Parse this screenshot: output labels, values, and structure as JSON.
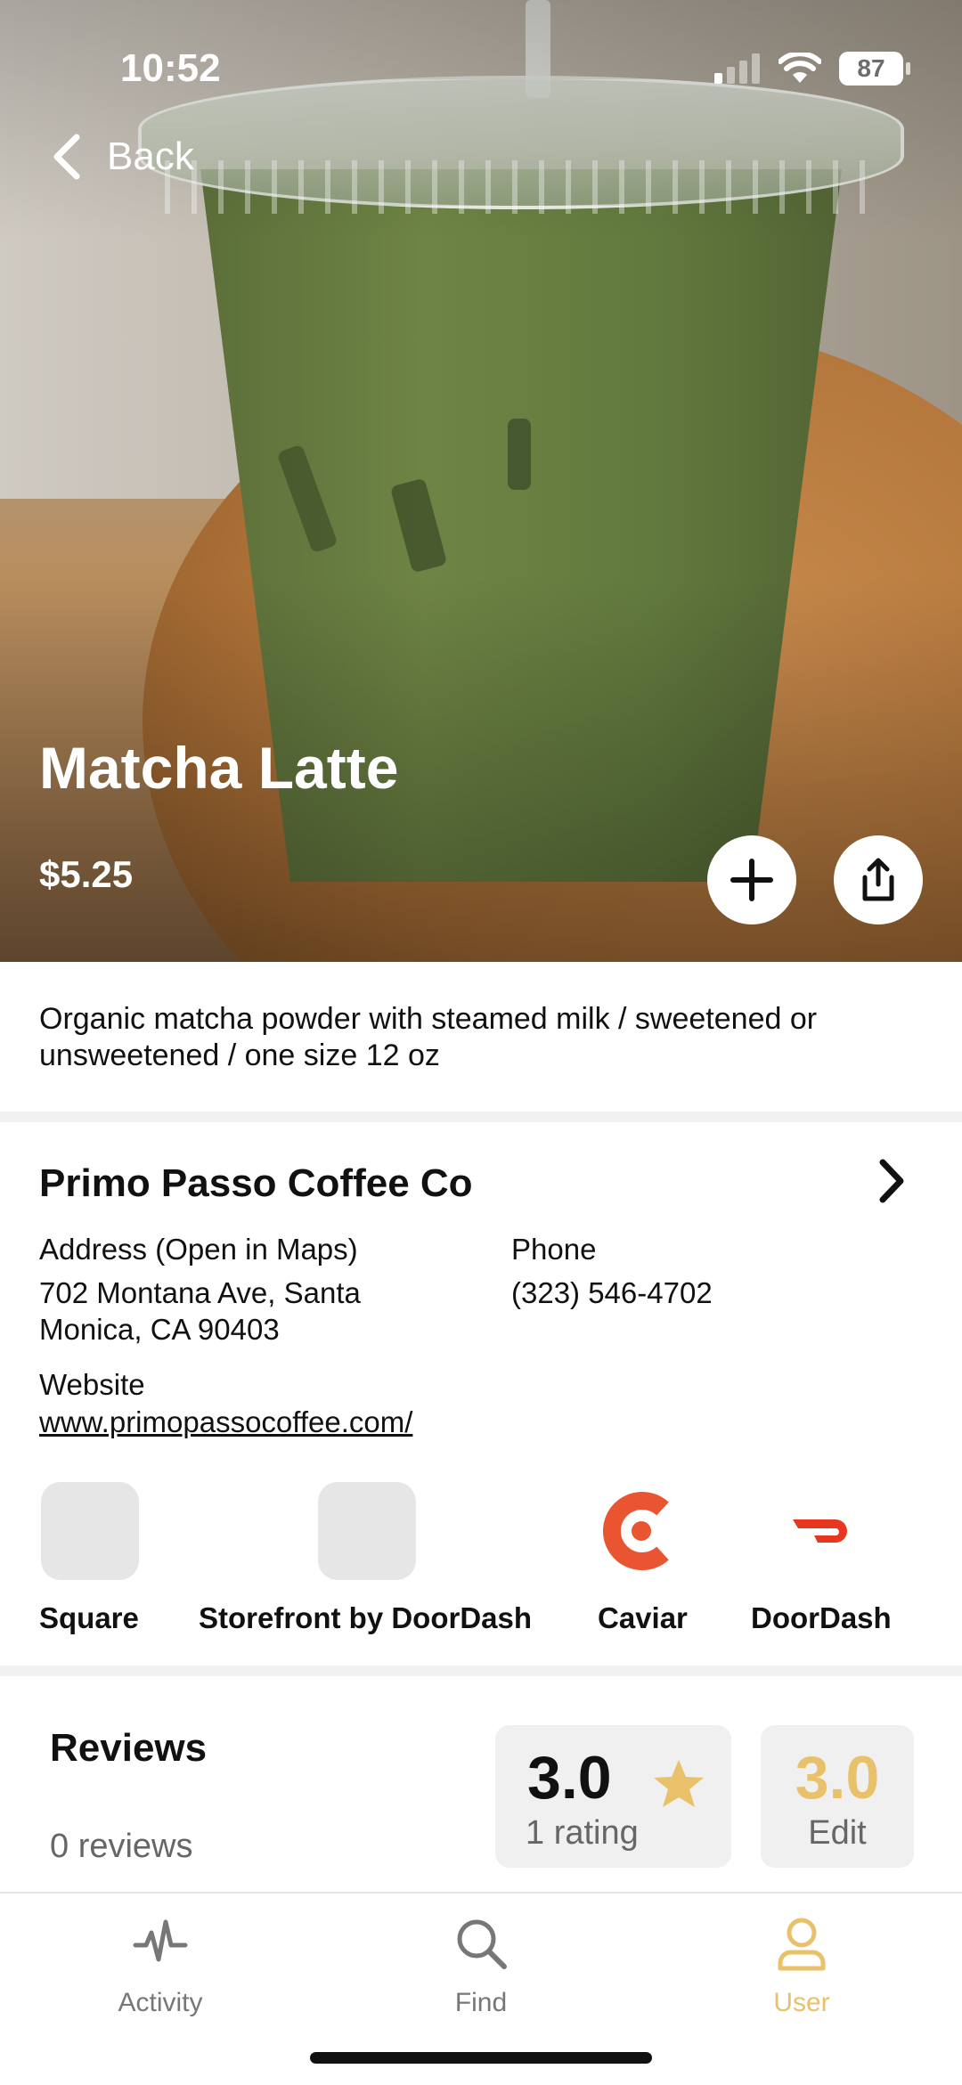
{
  "status_bar": {
    "time": "10:52",
    "battery": "87"
  },
  "nav": {
    "back_label": "Back"
  },
  "product": {
    "name": "Matcha Latte",
    "price": "$5.25",
    "description": "Organic matcha powder with steamed milk / sweetened or unsweetened / one size 12 oz"
  },
  "merchant": {
    "name": "Primo Passo Coffee Co",
    "address_label": "Address (Open in Maps)",
    "address_line1": "702 Montana Ave, Santa",
    "address_line2": "Monica, CA 90403",
    "phone_label": "Phone",
    "phone": "(323) 546-4702",
    "website_label": "Website",
    "website": "www.primopassocoffee.com/"
  },
  "ordering_services": [
    {
      "label": "Square",
      "icon": "square-logo-placeholder"
    },
    {
      "label": "Storefront by DoorDash",
      "icon": "storefront-logo-placeholder"
    },
    {
      "label": "Caviar",
      "icon": "caviar-logo",
      "color": "#e85530"
    },
    {
      "label": "DoorDash",
      "icon": "doordash-logo",
      "color": "#e8371f"
    }
  ],
  "reviews": {
    "title": "Reviews",
    "count_text": "0 reviews",
    "average": "3.0",
    "ratings_text": "1 rating",
    "my_rating": "3.0",
    "edit_label": "Edit"
  },
  "tabbar": {
    "items": [
      {
        "label": "Activity",
        "icon": "activity-icon",
        "active": false
      },
      {
        "label": "Find",
        "icon": "search-icon",
        "active": false
      },
      {
        "label": "User",
        "icon": "user-icon",
        "active": true
      }
    ]
  },
  "colors": {
    "accent": "#e8c16a",
    "caviar": "#e85530",
    "doordash": "#e8371f"
  }
}
